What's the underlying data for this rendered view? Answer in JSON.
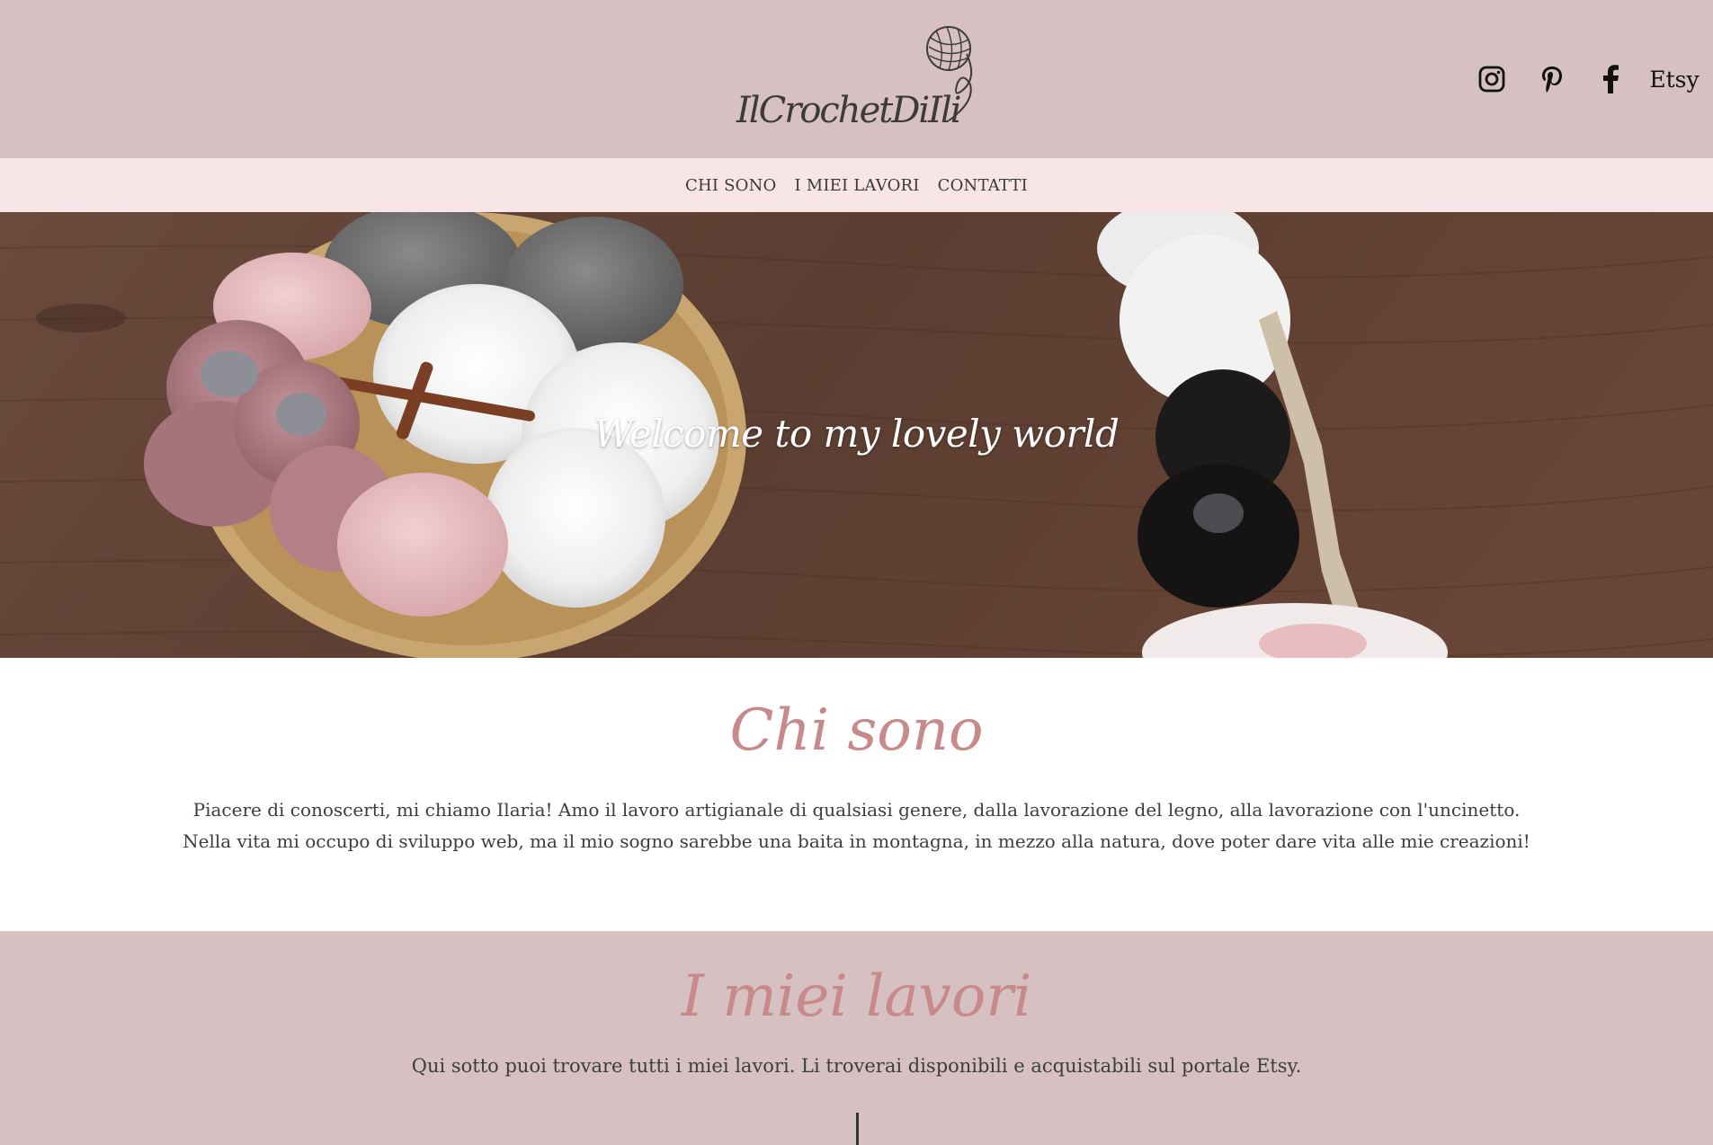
{
  "brand": {
    "logo_text": "IlCrochetDiIli",
    "yarn_icon": "yarn-ball-icon"
  },
  "social": {
    "instagram_icon": "instagram-icon",
    "pinterest_icon": "pinterest-icon",
    "facebook_icon": "facebook-icon",
    "etsy_label": "Etsy"
  },
  "nav": {
    "items": [
      {
        "label": "CHI SONO"
      },
      {
        "label": "I MIEI LAVORI"
      },
      {
        "label": "CONTATTI"
      }
    ]
  },
  "hero": {
    "title": "Welcome to my lovely world"
  },
  "about": {
    "title": "Chi sono",
    "line1": "Piacere di conoscerti, mi chiamo Ilaria! Amo il lavoro artigianale di qualsiasi genere, dalla lavorazione del legno, alla lavorazione con l'uncinetto.",
    "line2": "Nella vita mi occupo di sviluppo web, ma il mio sogno sarebbe una baita in montagna, in mezzo alla natura, dove poter dare vita alle mie creazioni!"
  },
  "works": {
    "title": "I miei lavori",
    "text": "Qui sotto puoi trovare tutti i miei lavori. Li troverai disponibili e acquistabili sul portale Etsy."
  },
  "colors": {
    "header_bg": "#d6c0c1",
    "nav_bg": "#f8e5e7",
    "accent": "#c8898a",
    "text": "#3d3d3d"
  }
}
